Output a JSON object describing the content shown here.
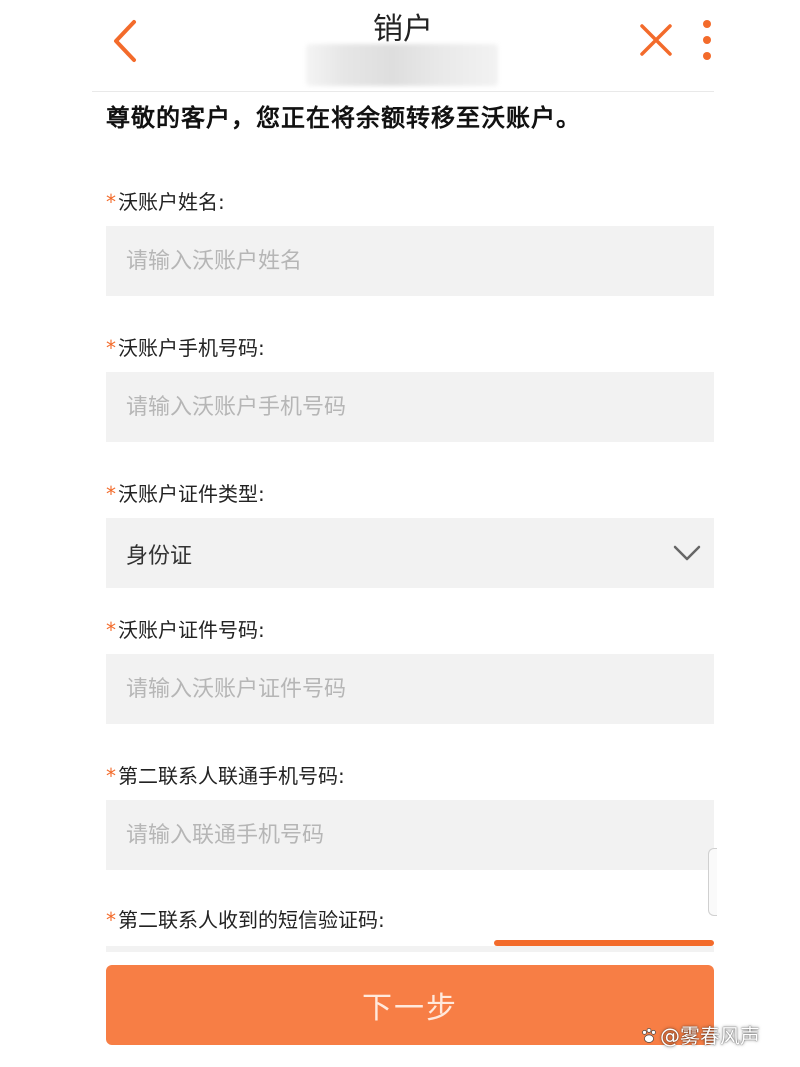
{
  "header": {
    "title": "销户",
    "back_icon": "chevron-left-icon",
    "close_icon": "close-icon",
    "more_icon": "more-vertical-icon"
  },
  "notice": "尊敬的客户，您正在将余额转移至沃账户。",
  "form": {
    "required_mark": "*",
    "fields": [
      {
        "label": "沃账户姓名:",
        "placeholder": "请输入沃账户姓名",
        "value": ""
      },
      {
        "label": "沃账户手机号码:",
        "placeholder": "请输入沃账户手机号码",
        "value": ""
      },
      {
        "label": "沃账户证件类型:",
        "selected": "身份证",
        "icon": "chevron-down-icon"
      },
      {
        "label": "沃账户证件号码:",
        "placeholder": "请输入沃账户证件号码",
        "value": ""
      },
      {
        "label": "第二联系人联通手机号码:",
        "placeholder": "请输入联通手机号码",
        "value": ""
      },
      {
        "label": "第二联系人收到的短信验证码:"
      }
    ]
  },
  "next_button": "下一步",
  "watermark": "@雾春风声",
  "colors": {
    "accent": "#f36b2b",
    "button": "#f77e45",
    "field_bg": "#f2f2f2",
    "placeholder": "#b6b6b6"
  }
}
